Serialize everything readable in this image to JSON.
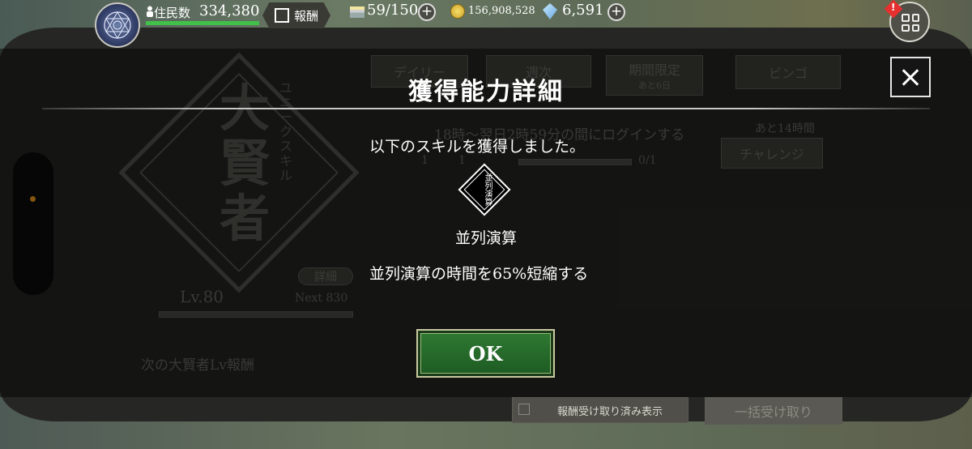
{
  "hud": {
    "population_label": "住民数",
    "population_value": "334,380",
    "population_progress": 1.0,
    "reward_label": "報酬",
    "stamina_value": "59/150",
    "coins_value": "156,908,528",
    "gems_value": "6,591",
    "plus": "+",
    "alert_mark": "!"
  },
  "background": {
    "skill_big": "大賢者",
    "skill_vertical": "ユニークスキル",
    "detail_label": "詳細",
    "level_label": "Lv.80",
    "next_label": "Next 830",
    "next_reward": "次の大賢者Lv報酬",
    "tab_daily": "デイリー",
    "tab_weekly": "週次",
    "tab_limited": "期間限定",
    "tab_limited_sub": "あと6日",
    "tab_bingo": "ビンゴ",
    "mission_text": "18時〜翌日2時59分の間にログインする",
    "mission_remaining": "あと14時間",
    "mission_count": "0/1",
    "mission_reward_a": "1",
    "mission_reward_b": "1",
    "challenge_label": "チャレンジ",
    "show_received_label": "報酬受け取り済み表示",
    "bulk_receive_label": "一括受け取り"
  },
  "modal": {
    "title": "獲得能力詳細",
    "intro": "以下のスキルを獲得しました。",
    "skill_icon_text": "並列演算",
    "skill_name": "並列演算",
    "skill_description": "並列演算の時間を65%短縮する",
    "ok_label": "OK"
  },
  "colors": {
    "ok_green": "#2f7a33",
    "progress_green": "#41c04a",
    "alert_red": "#e63030",
    "indicator_orange": "#f39a1c"
  }
}
